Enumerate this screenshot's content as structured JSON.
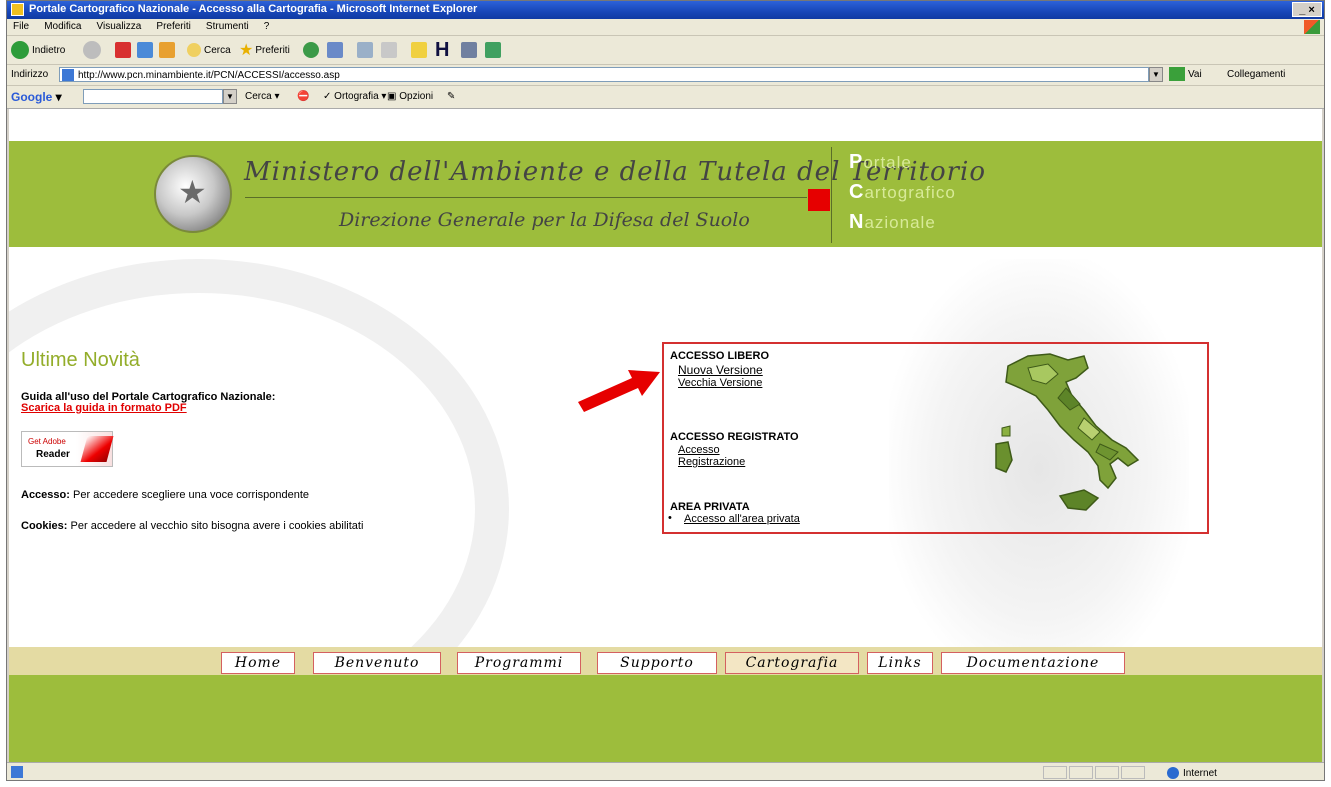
{
  "window": {
    "title": "Portale Cartografico Nazionale - Accesso alla Cartografia - Microsoft Internet Explorer",
    "controls": "_ ×"
  },
  "menu": [
    "File",
    "Modifica",
    "Visualizza",
    "Preferiti",
    "Strumenti",
    "?"
  ],
  "toolbar": {
    "back": "Indietro",
    "search": "Cerca",
    "favorites": "Preferiti"
  },
  "address": {
    "label": "Indirizzo",
    "url": "http://www.pcn.minambiente.it/PCN/ACCESSI/accesso.asp",
    "go": "Vai",
    "links": "Collegamenti"
  },
  "google": {
    "logo": "Google",
    "search": "Cerca",
    "spell": "Ortografia",
    "options": "Opzioni"
  },
  "header": {
    "ministry": "Ministero dell'Ambiente e della Tutela del Territorio",
    "direction": "Direzione Generale per la Difesa del Suolo",
    "pcn": [
      {
        "initial": "P",
        "rest": "ortale"
      },
      {
        "initial": "C",
        "rest": "artografico"
      },
      {
        "initial": "N",
        "rest": "azionale"
      }
    ]
  },
  "news": {
    "title": "Ultime Novità",
    "guide_label": "Guida all'uso del Portale Cartografico Nazionale:",
    "guide_link": "Scarica la guida in formato PDF",
    "adobe_top": "Get Adobe",
    "adobe_bottom": "Reader",
    "access_key": "Accesso:",
    "access_text": "Per accedere scegliere una voce corrispondente",
    "cookies_key": "Cookies:",
    "cookies_text": "Per accedere al vecchio sito bisogna avere i cookies abilitati"
  },
  "access": {
    "free_title": "ACCESSO LIBERO",
    "new_version": "Nuova Versione",
    "old_version": "Vecchia Versione",
    "registered_title": "ACCESSO REGISTRATO",
    "login": "Accesso",
    "register": "Registrazione",
    "private_title": "AREA PRIVATA",
    "private_link": "Accesso all'area privata"
  },
  "nav": [
    "Home",
    "Benvenuto",
    "Programmi",
    "Supporto",
    "Cartografia",
    "Links",
    "Documentazione"
  ],
  "nav_active": "Cartografia",
  "status": {
    "zone": "Internet"
  },
  "colors": {
    "header_green": "#9dbd3c",
    "nav_band": "#e4dba3",
    "highlight_red": "#d43030",
    "arrow": "#e60000"
  }
}
